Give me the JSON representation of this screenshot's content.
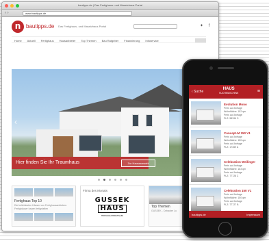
{
  "browser": {
    "window_title": "bautipps.de | Das Fertighaus- und Massivhaus Portal",
    "url": "www.bautipps.de",
    "traffic_light_colors": [
      "#fc5f57",
      "#fdbc2e",
      "#28c840"
    ]
  },
  "site": {
    "logo_letter": "n",
    "logo_text": "bautipps.de",
    "tagline": "Das Fertighaus- und Massivhaus Portal",
    "social_icons": [
      "twitter-icon",
      "facebook-icon"
    ],
    "social_glyphs": "✦ f",
    "brand_color": "#c0282c"
  },
  "nav": {
    "items": [
      "Home",
      "Aktuell",
      "Fertighaus",
      "Hausanbieter",
      "Top Themen",
      "Bau Ratgeber",
      "Finanzierung",
      "Infoservice"
    ]
  },
  "hero": {
    "headline": "Hier finden Sie Ihr Traumhaus",
    "button_label": "Zur Hausauswahl",
    "prev_arrow": "‹",
    "next_arrow": "›",
    "active_slide": 1,
    "slide_count": 6
  },
  "cards": {
    "card1": {
      "title": "Fertighaus Top 10",
      "desc": "Die beliebtesten Häuser von Fertighausanbietern. Fertighäuser bauen fertigstellen"
    },
    "card2": {
      "title": "Firma des Monats",
      "logo_line1": "GUSSEK",
      "logo_line2": "HAUS",
      "logo_sub": "FERTIGHAUSHERSTELLER"
    },
    "card3": {
      "title": "Top Themen",
      "desc": "GUSSEK - Cebauter Lu"
    }
  },
  "mobile": {
    "back_label": "‹ Suche",
    "header_logo_line1": "HAUS",
    "header_logo_line2": "SUCHMASCHINE",
    "menu_glyph": "≡",
    "accent": "#b21f24",
    "items": [
      {
        "title": "Evolution Mono",
        "l1": "Preis auf Anfrage",
        "l2": "Wohnfläche: 152 qm",
        "l3": "Preis auf Anfrage",
        "l4": "PLZ: 58396 S"
      },
      {
        "title": "Concept-M 150 V1",
        "l1": "Preis auf Anfrage",
        "l2": "Wohnfläche: 150 qm",
        "l3": "Preis auf Anfrage",
        "l4": "PLZ: 17369 A"
      },
      {
        "title": "Celebration Weilinger",
        "l1": "Preis auf Anfrage",
        "l2": "Wohnfläche: 163 qm",
        "l3": "Preis auf Anfrage",
        "l4": "PLZ: 77728 Z"
      },
      {
        "title": "Celebration 150 V1",
        "l1": "Preis auf Anfrage",
        "l2": "Wohnfläche: 150 qm",
        "l3": "Preis auf Anfrage",
        "l4": "PLZ: 77727 B"
      }
    ],
    "footer_left": "bautipps.de",
    "footer_right": "Impressum"
  }
}
